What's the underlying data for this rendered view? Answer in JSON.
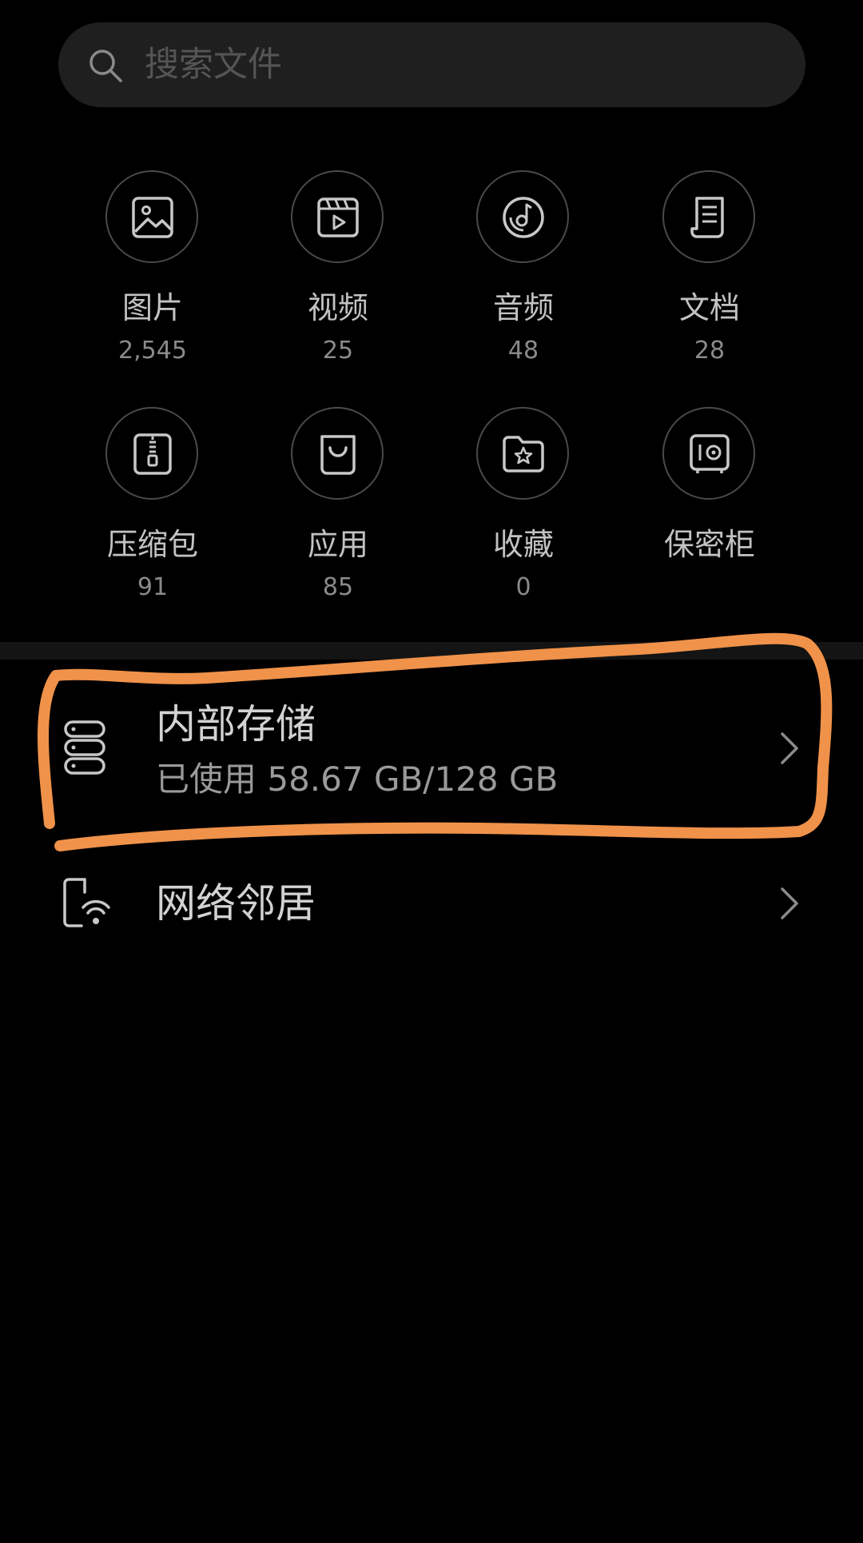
{
  "search": {
    "placeholder": "搜索文件",
    "icon": "search-icon"
  },
  "categories": [
    {
      "label": "图片",
      "count": "2,545",
      "icon": "image-icon"
    },
    {
      "label": "视频",
      "count": "25",
      "icon": "video-icon"
    },
    {
      "label": "音频",
      "count": "48",
      "icon": "audio-icon"
    },
    {
      "label": "文档",
      "count": "28",
      "icon": "document-icon"
    },
    {
      "label": "压缩包",
      "count": "91",
      "icon": "archive-icon"
    },
    {
      "label": "应用",
      "count": "85",
      "icon": "app-bag-icon"
    },
    {
      "label": "收藏",
      "count": "0",
      "icon": "favorite-folder-icon"
    },
    {
      "label": "保密柜",
      "count": "",
      "icon": "safe-icon"
    }
  ],
  "storage": {
    "internal": {
      "title": "内部存储",
      "usage": "已使用 58.67 GB/128 GB",
      "icon": "storage-icon"
    },
    "network": {
      "title": "网络邻居",
      "icon": "network-device-icon"
    }
  },
  "colors": {
    "background": "#000000",
    "search_bg": "#1f1f1f",
    "highlight_annotation": "#f0924a"
  }
}
